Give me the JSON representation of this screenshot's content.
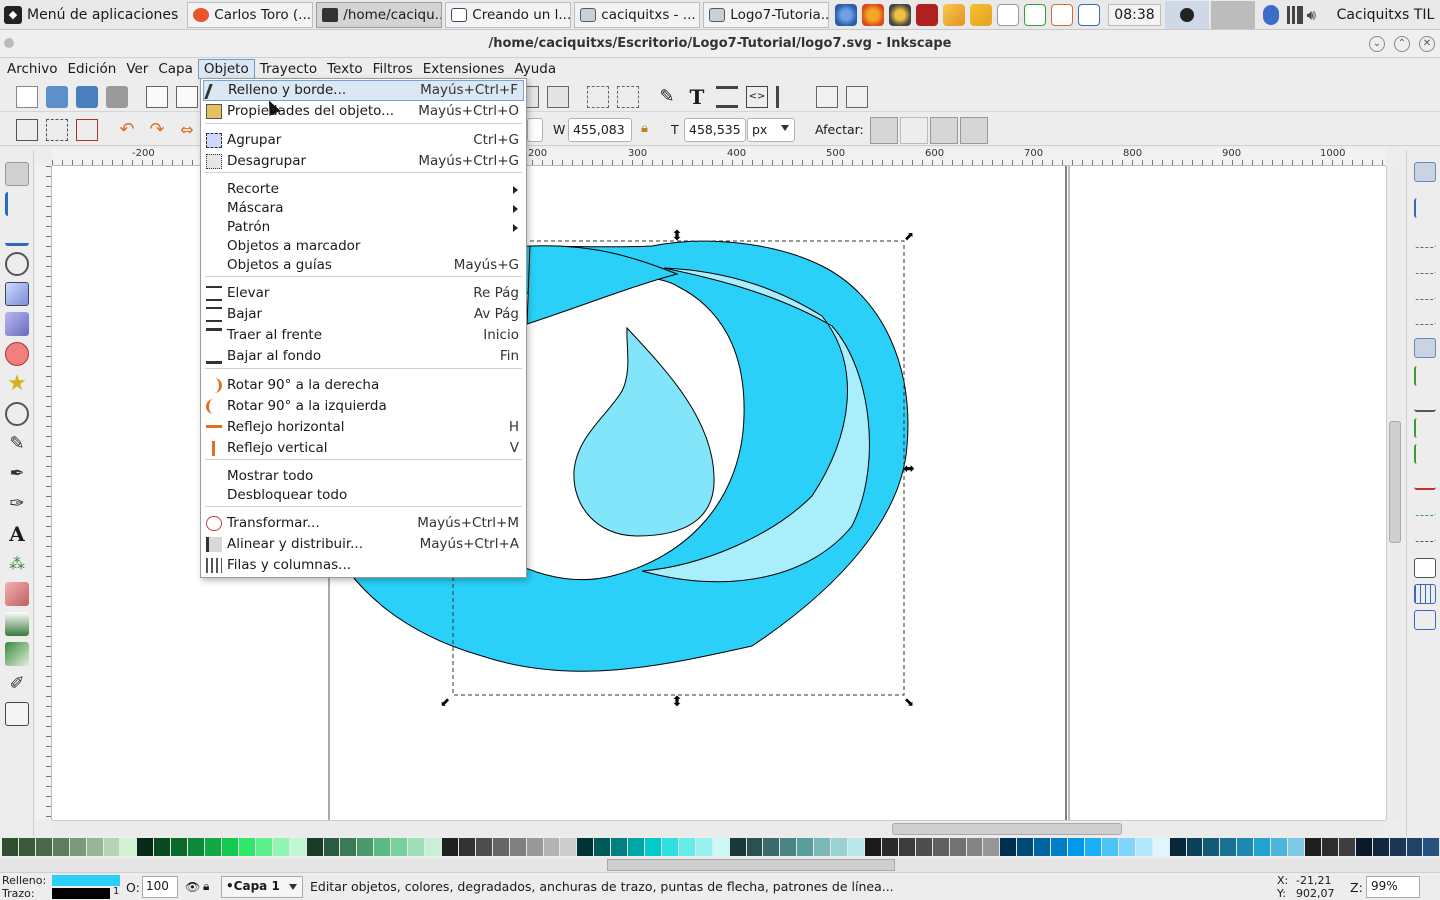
{
  "taskbar": {
    "app_menu": "Menú de aplicaciones",
    "tasks": [
      "Carlos Toro (...",
      "/home/caciqu...",
      "Creando un l...",
      "caciquitxs - ...",
      "Logo7-Tutoria..."
    ],
    "clock": "08:38",
    "user": "Caciquitxs TIL"
  },
  "window": {
    "title": "/home/caciquitxs/Escritorio/Logo7-Tutorial/logo7.svg - Inkscape"
  },
  "menubar": [
    "Archivo",
    "Edición",
    "Ver",
    "Capa",
    "Objeto",
    "Trayecto",
    "Texto",
    "Filtros",
    "Extensiones",
    "Ayuda"
  ],
  "menubar_active": "Objeto",
  "controls": {
    "w_label": "W",
    "w_value": "455,083",
    "h_label": "T",
    "h_value": "458,535",
    "unit": "px",
    "affect_label": "Afectar:"
  },
  "rulers": {
    "h_ticks": [
      "-200",
      "200",
      "300",
      "400",
      "500",
      "600",
      "700",
      "800",
      "900",
      "1000"
    ]
  },
  "object_menu": {
    "items": [
      {
        "label": "Relleno y borde...",
        "accel": "Mayús+Ctrl+F",
        "icon": "pen-icon"
      },
      {
        "label": "Propiedades del objeto...",
        "accel": "Mayús+Ctrl+O",
        "icon": "properties-icon"
      },
      {
        "label": "Agrupar",
        "accel": "Ctrl+G",
        "icon": "group-icon"
      },
      {
        "label": "Desagrupar",
        "accel": "Mayús+Ctrl+G",
        "icon": "ungroup-icon"
      },
      {
        "label": "Recorte",
        "accel": "",
        "icon": ""
      },
      {
        "label": "Máscara",
        "accel": "",
        "icon": ""
      },
      {
        "label": "Patrón",
        "accel": "",
        "icon": ""
      },
      {
        "label": "Objetos a marcador",
        "accel": "",
        "icon": ""
      },
      {
        "label": "Objetos a guías",
        "accel": "Mayús+G",
        "icon": ""
      },
      {
        "label": "Elevar",
        "accel": "Re Pág",
        "icon": "raise-icon"
      },
      {
        "label": "Bajar",
        "accel": "Av Pág",
        "icon": "lower-icon"
      },
      {
        "label": "Traer al frente",
        "accel": "Inicio",
        "icon": "raise-top-icon"
      },
      {
        "label": "Bajar al fondo",
        "accel": "Fin",
        "icon": "lower-bottom-icon"
      },
      {
        "label": "Rotar 90° a la derecha",
        "accel": "",
        "icon": "rotate-cw-icon"
      },
      {
        "label": "Rotar 90° a la izquierda",
        "accel": "",
        "icon": "rotate-ccw-icon"
      },
      {
        "label": "Reflejo horizontal",
        "accel": "H",
        "icon": "flip-h-icon"
      },
      {
        "label": "Reflejo vertical",
        "accel": "V",
        "icon": "flip-v-icon"
      },
      {
        "label": "Mostrar todo",
        "accel": "",
        "icon": ""
      },
      {
        "label": "Desbloquear todo",
        "accel": "",
        "icon": ""
      },
      {
        "label": "Transformar...",
        "accel": "Mayús+Ctrl+M",
        "icon": "transform-icon"
      },
      {
        "label": "Alinear y distribuir...",
        "accel": "Mayús+Ctrl+A",
        "icon": "align-icon"
      },
      {
        "label": "Filas y columnas...",
        "accel": "",
        "icon": "grid-icon"
      }
    ]
  },
  "status": {
    "fill_label": "Relleno:",
    "stroke_label": "Trazo:",
    "stroke_width": "1",
    "opacity_label": "O:",
    "opacity_value": "100",
    "layer": "•Capa 1",
    "message": "Editar objetos, colores, degradados, anchuras de trazo, puntas de flecha, patrones de línea...",
    "x_label": "X:",
    "x_value": "-21,21",
    "y_label": "Y:",
    "y_value": "902,07",
    "zoom_label": "Z:",
    "zoom_value": "99%"
  },
  "colors": {
    "logo_main": "#2ad0f7",
    "logo_light": "#82e5fa",
    "logo_lighter": "#a8eefb",
    "fill_swatch": "#2ad0f7",
    "stroke_swatch": "#000000",
    "menu_highlight": "#dbe7f3"
  },
  "palette": [
    "#2f4f2f",
    "#3a5a3a",
    "#4a6a4a",
    "#5e7e5e",
    "#7a9a7a",
    "#96b696",
    "#b4d4b4",
    "#d2f2d2",
    "#052a15",
    "#0a4a20",
    "#0b6a2a",
    "#0e8a36",
    "#11aa42",
    "#14ca4e",
    "#2ee86a",
    "#5ff08e",
    "#8ff5b0",
    "#bff9d2",
    "#1c3a2c",
    "#2a5a40",
    "#3a7a56",
    "#4a9a6c",
    "#5aba82",
    "#7ad09a",
    "#a0e0b8",
    "#c8f0d8",
    "#202020",
    "#333333",
    "#4d4d4d",
    "#666666",
    "#808080",
    "#999999",
    "#b3b3b3",
    "#cccccc",
    "#003333",
    "#005a5a",
    "#008080",
    "#00a6a6",
    "#00cccc",
    "#2ee0e0",
    "#66ebeb",
    "#99f2f2",
    "#ccf8f8",
    "#1a3a3a",
    "#2a5050",
    "#3a6a6a",
    "#4a8484",
    "#5a9e9e",
    "#7ab8b8",
    "#9ad2d2",
    "#bae8e8",
    "#1a1a1a",
    "#2a2a2a",
    "#3c3c3c",
    "#4e4e4e",
    "#606060",
    "#727272",
    "#848484",
    "#969696",
    "#003050",
    "#004a78",
    "#0064a0",
    "#007ec8",
    "#0098e8",
    "#1ab0f5",
    "#4cc4f8",
    "#80d6fa",
    "#b3e8fc",
    "#e0f6fe",
    "#062a3a",
    "#0c4258",
    "#125a76",
    "#187294",
    "#1e8ab2",
    "#24a2d0",
    "#4ab6dc",
    "#7ccae6",
    "#1e1e1e",
    "#2e2e2e",
    "#3e3e3e",
    "#0a1a2a",
    "#12283e",
    "#1a3652",
    "#204468",
    "#28527e"
  ]
}
